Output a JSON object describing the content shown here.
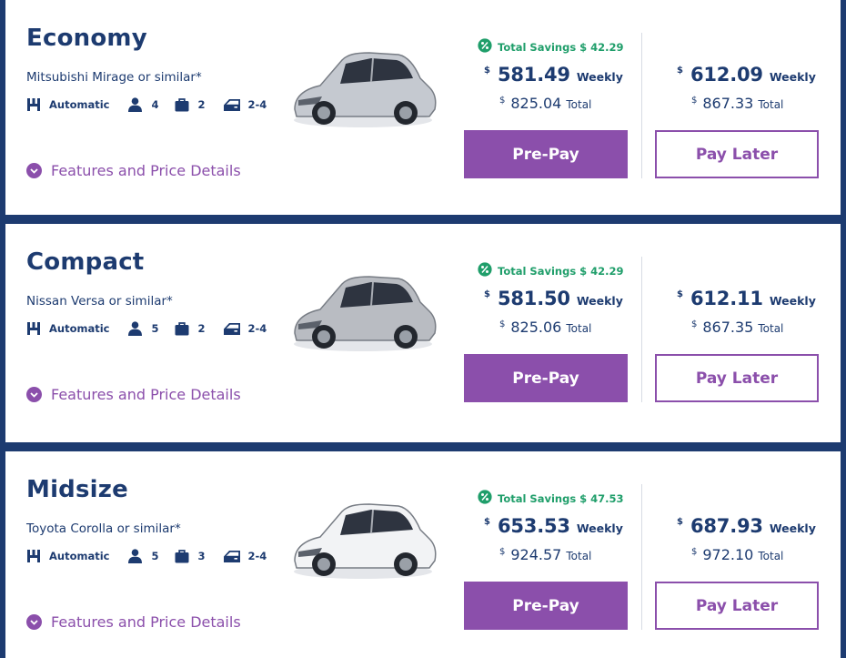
{
  "colors": {
    "navy": "#1d3b70",
    "purple": "#8b4fab",
    "green": "#1f9e6a",
    "background": "#1d3b70"
  },
  "icons": {
    "transmission": "transmission-icon",
    "seats": "person-icon",
    "bags": "suitcase-icon",
    "doors": "car-door-icon",
    "features": "chevron-down-icon",
    "savings": "percent-badge-icon"
  },
  "features_label": "Features and Price Details",
  "prepay_label": "Pre-Pay",
  "paylater_label": "Pay Later",
  "currency_symbol": "$",
  "weekly_label": "Weekly",
  "total_label": "Total",
  "vehicles": [
    {
      "class_name": "Economy",
      "model": "Mitsubishi Mirage or similar*",
      "transmission": "Automatic",
      "seats": "4",
      "bags": "2",
      "doors": "2-4",
      "car_image": "silver hatchback",
      "savings": "Total Savings $ 42.29",
      "prepay_weekly": "581.49",
      "prepay_total": "825.04",
      "paylater_weekly": "612.09",
      "paylater_total": "867.33"
    },
    {
      "class_name": "Compact",
      "model": "Nissan Versa or similar*",
      "transmission": "Automatic",
      "seats": "5",
      "bags": "2",
      "doors": "2-4",
      "car_image": "silver sedan",
      "savings": "Total Savings $ 42.29",
      "prepay_weekly": "581.50",
      "prepay_total": "825.06",
      "paylater_weekly": "612.11",
      "paylater_total": "867.35"
    },
    {
      "class_name": "Midsize",
      "model": "Toyota Corolla or similar*",
      "transmission": "Automatic",
      "seats": "5",
      "bags": "3",
      "doors": "2-4",
      "car_image": "white sedan",
      "savings": "Total Savings $ 47.53",
      "prepay_weekly": "653.53",
      "prepay_total": "924.57",
      "paylater_weekly": "687.93",
      "paylater_total": "972.10"
    }
  ]
}
